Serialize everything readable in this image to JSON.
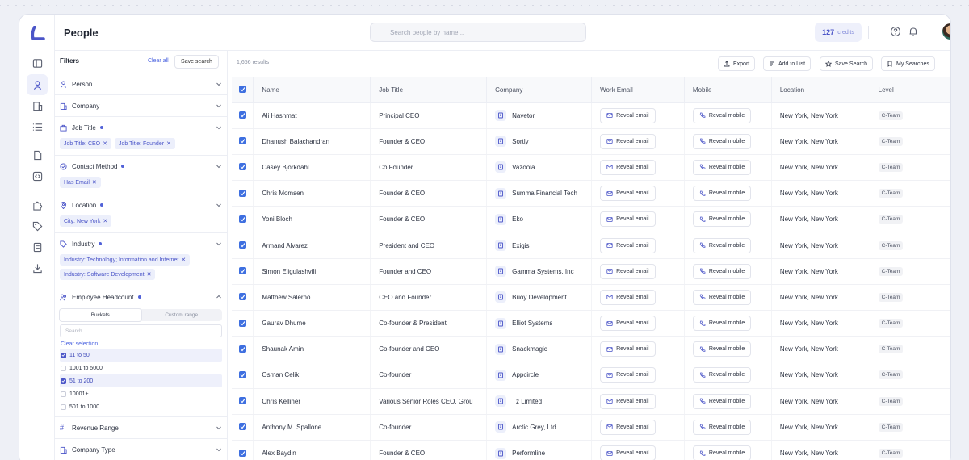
{
  "header": {
    "title": "People",
    "search_placeholder": "Search people by name...",
    "credits_value": "127",
    "credits_label": "credits"
  },
  "rail": {
    "icons": [
      "sidebar-toggle-icon",
      "person-icon",
      "building-icon",
      "list-icon",
      "document-icon",
      "code-icon",
      "puzzle-icon",
      "tag-icon",
      "receipt-icon",
      "download-icon"
    ]
  },
  "filters": {
    "title": "Filters",
    "clear_all": "Clear all",
    "save_search": "Save search",
    "sections": {
      "person": "Person",
      "company": "Company",
      "job_title": "Job Title",
      "contact_method": "Contact Method",
      "location": "Location",
      "industry": "Industry",
      "headcount": "Employee Headcount",
      "revenue": "Revenue Range",
      "company_type": "Company Type"
    },
    "chips": {
      "job_title": [
        "Job Title: CEO",
        "Job Title: Founder"
      ],
      "contact_method": [
        "Has Email"
      ],
      "location": [
        "City: New York"
      ],
      "industry": [
        "Industry: Technology; Information and Internet",
        "Industry: Software Development"
      ]
    },
    "headcount": {
      "tab_buckets": "Buckets",
      "tab_custom": "Custom range",
      "search_placeholder": "Search...",
      "clear_selection": "Clear selection",
      "options": [
        {
          "label": "11 to 50",
          "selected": true
        },
        {
          "label": "1001 to 5000",
          "selected": false
        },
        {
          "label": "51 to 200",
          "selected": true
        },
        {
          "label": "10001+",
          "selected": false
        },
        {
          "label": "501 to 1000",
          "selected": false
        }
      ]
    }
  },
  "results": {
    "count": "1,656 results",
    "toolbar": {
      "export": "Export",
      "add_to_list": "Add to List",
      "save_search": "Save Search",
      "my_searches": "My Searches"
    },
    "columns": [
      "Name",
      "Job Title",
      "Company",
      "Work Email",
      "Mobile",
      "Location",
      "Level"
    ],
    "reveal_email": "Reveal email",
    "reveal_mobile": "Reveal mobile",
    "rows": [
      {
        "name": "Ali Hashmat",
        "title": "Principal CEO",
        "company": "Navetor",
        "location": "New York, New York",
        "level": "C-Team"
      },
      {
        "name": "Dhanush Balachandran",
        "title": "Founder & CEO",
        "company": "Sortly",
        "location": "New York, New York",
        "level": "C-Team"
      },
      {
        "name": "Casey Bjorkdahl",
        "title": "Co Founder",
        "company": "Vazoola",
        "location": "New York, New York",
        "level": "C-Team"
      },
      {
        "name": "Chris Momsen",
        "title": "Founder & CEO",
        "company": "Summa Financial Tech",
        "location": "New York, New York",
        "level": "C-Team"
      },
      {
        "name": "Yoni Bloch",
        "title": "Founder & CEO",
        "company": "Eko",
        "location": "New York, New York",
        "level": "C-Team"
      },
      {
        "name": "Armand Alvarez",
        "title": "President and CEO",
        "company": "Exigis",
        "location": "New York, New York",
        "level": "C-Team"
      },
      {
        "name": "Simon Eligulashvili",
        "title": "Founder and CEO",
        "company": "Gamma Systems, Inc",
        "location": "New York, New York",
        "level": "C-Team"
      },
      {
        "name": "Matthew Salerno",
        "title": "CEO and Founder",
        "company": "Buoy Development",
        "location": "New York, New York",
        "level": "C-Team"
      },
      {
        "name": "Gaurav Dhume",
        "title": "Co-founder & President",
        "company": "Elliot Systems",
        "location": "New York, New York",
        "level": "C-Team"
      },
      {
        "name": "Shaunak Amin",
        "title": "Co-founder and CEO",
        "company": "Snackmagic",
        "location": "New York, New York",
        "level": "C-Team"
      },
      {
        "name": "Osman Celik",
        "title": "Co-founder",
        "company": "Appcircle",
        "location": "New York, New York",
        "level": "C-Team"
      },
      {
        "name": "Chris Kelliher",
        "title": "Various Senior Roles CEO, Grou",
        "company": "Tz Limited",
        "location": "New York, New York",
        "level": "C-Team"
      },
      {
        "name": "Anthony M. Spallone",
        "title": "Co-founder",
        "company": "Arctic Grey, Ltd",
        "location": "New York, New York",
        "level": "C-Team"
      },
      {
        "name": "Alex Baydin",
        "title": "Founder & CEO",
        "company": "Performline",
        "location": "New York, New York",
        "level": "C-Team"
      }
    ]
  },
  "colors": {
    "accent": "#4b55c8",
    "checkbox": "#3e6fe0",
    "chip_bg": "#eceffb"
  }
}
